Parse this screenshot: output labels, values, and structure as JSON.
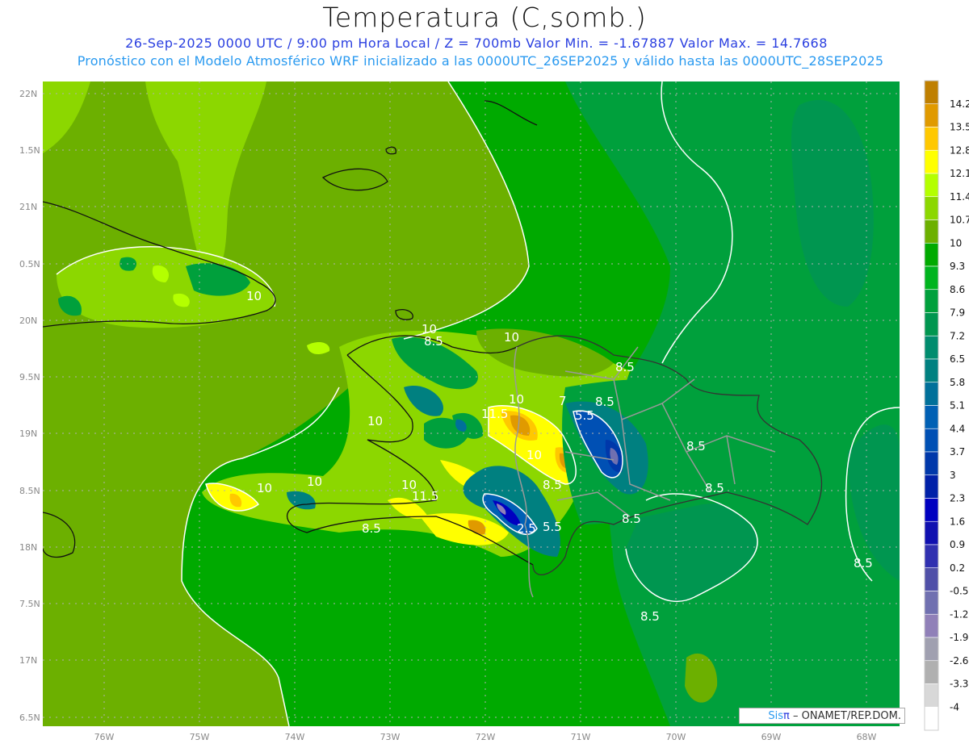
{
  "header": {
    "title": "Temperatura (C,somb.)",
    "subtitle_line1": "26-Sep-2025  0000 UTC / 9:00 pm Hora Local / Z = 700mb   Valor Min. = -1.67887  Valor Max. = 14.7668",
    "subtitle_line2": "Pronóstico con el Modelo Atmosférico WRF inicializado a las 0000UTC_26SEP2025 y válido hasta las  0000UTC_28SEP2025"
  },
  "map": {
    "variable": "Temperatura",
    "units": "C",
    "level": "700mb",
    "min_value": -1.67887,
    "max_value": 14.7668,
    "lon_labels": [
      "76W",
      "75W",
      "74W",
      "73W",
      "72W",
      "71W",
      "70W",
      "69W",
      "68W"
    ],
    "lat_labels": [
      "22N",
      "1.5N",
      "21N",
      "0.5N",
      "20N",
      "9.5N",
      "19N",
      "8.5N",
      "18N",
      "7.5N",
      "17N",
      "6.5N"
    ],
    "contour_labels": [
      "10",
      "8.5",
      "10",
      "10",
      "11.5",
      "10",
      "7",
      "8.5",
      "5.5",
      "8.5",
      "10",
      "8.5",
      "10",
      "10",
      "11.5",
      "10",
      "10",
      "8.5",
      "2.5",
      "5.5",
      "8.5",
      "8.5",
      "8.5",
      "8.5",
      "8.5"
    ]
  },
  "colorbar": {
    "colors": [
      "#bf7f00",
      "#e09a00",
      "#ffc800",
      "#ffff00",
      "#b4ff00",
      "#8cd700",
      "#6cb000",
      "#00aa00",
      "#00b41e",
      "#00a03c",
      "#009650",
      "#008c6e",
      "#008080",
      "#00709a",
      "#0060b4",
      "#0050b4",
      "#0038aa",
      "#0020a8",
      "#0000c0",
      "#1010b0",
      "#3030b0",
      "#5050a8",
      "#7070b0",
      "#9080b8",
      "#a0a0b0",
      "#b0b0b0",
      "#d8d8d8",
      "#ffffff"
    ],
    "labels": [
      "14.2",
      "13.5",
      "12.8",
      "12.1",
      "11.4",
      "10.7",
      "10",
      "9.3",
      "8.6",
      "7.9",
      "7.2",
      "6.5",
      "5.8",
      "5.1",
      "4.4",
      "3.7",
      "3",
      "2.3",
      "1.6",
      "0.9",
      "0.2",
      "-0.5",
      "-1.2",
      "-1.9",
      "-2.6",
      "-3.3",
      "-4"
    ]
  },
  "credit": {
    "sis": "Sis",
    "pi": "π",
    "rest": " – ONAMET/REP.DOM."
  }
}
